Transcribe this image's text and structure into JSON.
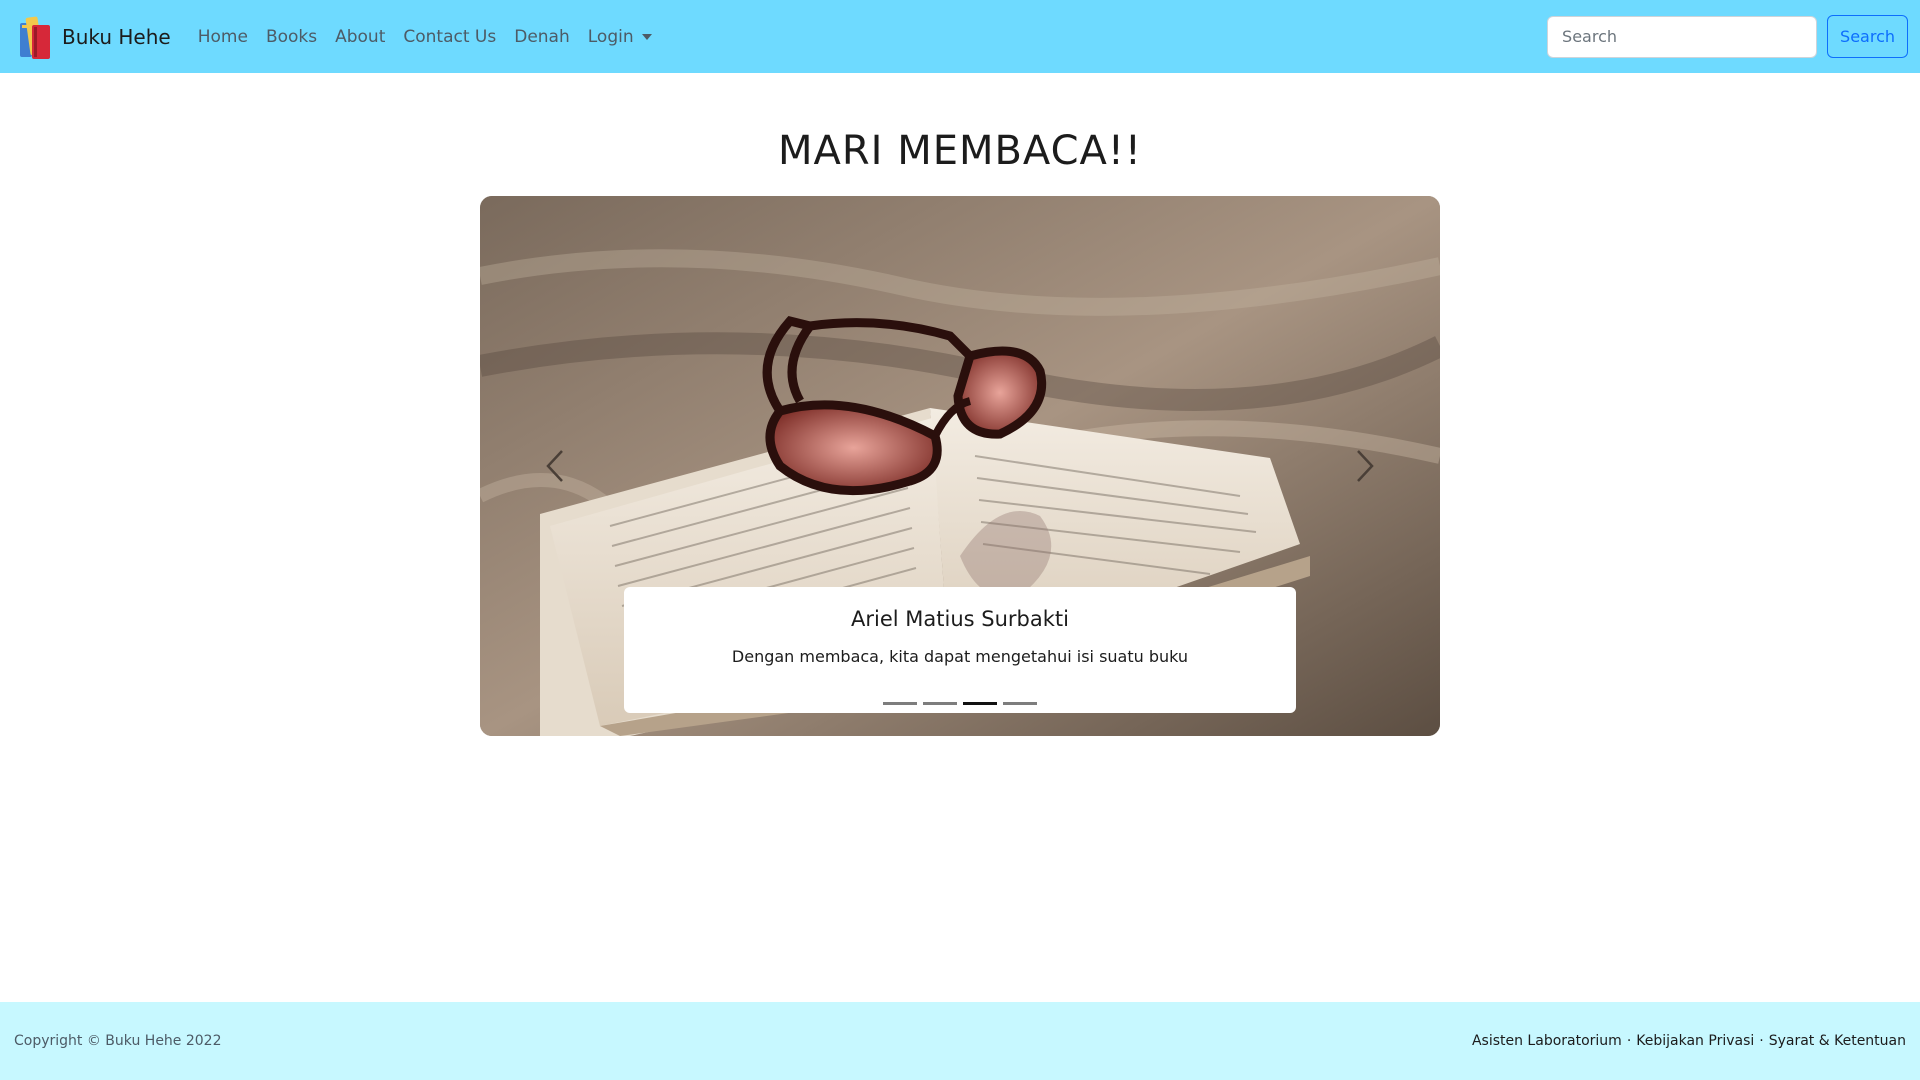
{
  "navbar": {
    "brand": "Buku Hehe",
    "links": [
      "Home",
      "Books",
      "About",
      "Contact Us",
      "Denah"
    ],
    "dropdown": "Login",
    "search_placeholder": "Search",
    "search_button": "Search",
    "colors": {
      "background": "#6edaff",
      "button": "#0d6efd"
    }
  },
  "main": {
    "title": "MARI MEMBACA!!",
    "carousel": {
      "caption_title": "Ariel Matius Surbakti",
      "caption_text": "Dengan membaca, kita dapat mengetahui isi suatu buku",
      "slide_count": 4,
      "active_slide": 3,
      "image_description_icon": "book-sunglasses-photo"
    }
  },
  "footer": {
    "copyright": "Copyright © Buku Hehe 2022",
    "links": [
      "Asisten Laboratorium",
      "Kebijakan Privasi",
      "Syarat & Ketentuan"
    ],
    "colors": {
      "background": "#c7f8ff"
    }
  }
}
